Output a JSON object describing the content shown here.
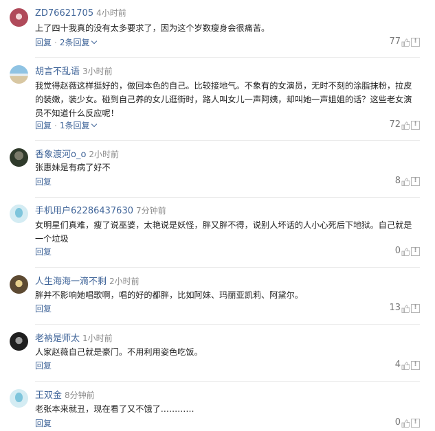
{
  "reply_label": "回复",
  "comments": [
    {
      "avatar": "avatar",
      "username": "ZD76621705",
      "time": "4小时前",
      "text": "上了四十我真的没有太多要求了，因为这个岁数瘦身会很痛苦。",
      "replies_label": "2条回复",
      "likes": "77"
    },
    {
      "avatar": "avatar",
      "username": "胡言不乱语",
      "time": "3小时前",
      "text": "我觉得赵薇这样挺好的，做回本色的自己。比较接地气。不象有的女演员，无时不刻的涂脂抹粉，拉皮的装嫩，装少女。碰到自己养的女儿逛街时，路人叫女儿一声阿姨，却叫她一声姐姐的话？这些老女演员不知道什么反应呢！",
      "replies_label": "1条回复",
      "likes": "72"
    },
    {
      "avatar": "avatar",
      "username": "香象渡河o_o",
      "time": "2小时前",
      "text": "张惠妹是有病了好不",
      "replies_label": "",
      "likes": "8"
    },
    {
      "avatar": "avatar",
      "username": "手机用户62286437630",
      "time": "7分钟前",
      "text": "女明星们真难，瘦了说巫婆，太艳说是妖怪，胖又胖不得，说别人坏话的人小心死后下地狱。自己就是一个垃圾",
      "replies_label": "",
      "likes": "0"
    },
    {
      "avatar": "avatar",
      "username": "人生海海一滴不剩",
      "time": "2小时前",
      "text": "胖并不影响她唱歌啊，唱的好的都胖，比如阿妹、玛丽亚凯莉、阿黛尔。",
      "replies_label": "",
      "likes": "13"
    },
    {
      "avatar": "avatar",
      "username": "老衲是师太",
      "time": "1小时前",
      "text": "人家赵薇自己就是豪门。不用利用姿色吃饭。",
      "replies_label": "",
      "likes": "4"
    },
    {
      "avatar": "avatar",
      "username": "王双金",
      "time": "8分钟前",
      "text": "老张本来就丑，现在看了又不饿了…………",
      "replies_label": "",
      "likes": "0"
    }
  ],
  "colors": {
    "username": "#406599",
    "time": "#8a8a8a",
    "text": "#222222",
    "divider": "#e9e9e9"
  },
  "icons": {
    "like": "thumbs-up-icon",
    "report": "report-icon",
    "expand": "chevron-down-icon"
  }
}
